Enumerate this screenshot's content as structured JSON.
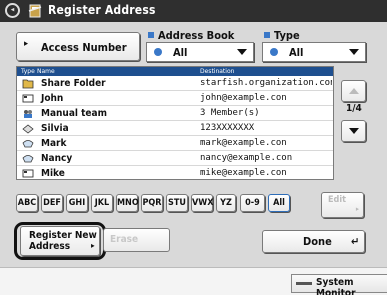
{
  "window": {
    "title": "Register Address"
  },
  "access_number_button": {
    "label": "Access Number"
  },
  "address_book": {
    "label": "Address Book",
    "value": "All"
  },
  "type_filter": {
    "label": "Type",
    "value": "All"
  },
  "list": {
    "columns": [
      "Type",
      "Name",
      "Destination"
    ],
    "rows": [
      {
        "icon": "folder-icon",
        "name": "Share Folder",
        "destination": "starfish.organization.conpa"
      },
      {
        "icon": "email-icon",
        "name": "John",
        "destination": "john@example.con"
      },
      {
        "icon": "group-icon",
        "name": "Manual team",
        "destination": "3 Member(s)"
      },
      {
        "icon": "fax-icon",
        "name": "Silvia",
        "destination": "123XXXXXXX"
      },
      {
        "icon": "ifax-icon",
        "name": "Mark",
        "destination": "mark@example.con"
      },
      {
        "icon": "ifax-icon",
        "name": "Nancy",
        "destination": "nancy@example.con"
      },
      {
        "icon": "email-icon",
        "name": "Mike",
        "destination": "mike@example.con"
      }
    ]
  },
  "pagination": {
    "indicator": "1/4"
  },
  "filters": [
    "ABC",
    "DEF",
    "GHI",
    "JKL",
    "MNO",
    "PQR",
    "STU",
    "VWX",
    "YZ",
    "0-9",
    "All"
  ],
  "edit_button": {
    "label": "Edit"
  },
  "register_new_button": {
    "line1": "Register New",
    "line2": "Address"
  },
  "erase_button": {
    "label": "Erase"
  },
  "done_button": {
    "label": "Done"
  },
  "system_monitor": {
    "label": "System Monitor"
  },
  "colors": {
    "accent": "#3a78c8",
    "header": "#1e4f8f",
    "titlebar": "#2f2f2f"
  }
}
